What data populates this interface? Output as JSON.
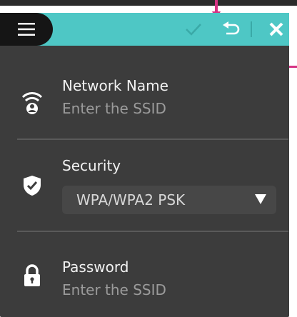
{
  "colors": {
    "header_accent": "#4ec7c5",
    "panel_bg": "#3c3c3c",
    "menu_bg": "#151515",
    "annotation": "#d63384"
  },
  "header": {
    "menu_icon": "hamburger-icon",
    "actions": [
      "check-icon",
      "undo-icon",
      "close-icon"
    ]
  },
  "network": {
    "icon": "wifi-person-icon",
    "label": "Network Name",
    "placeholder": "Enter the SSID"
  },
  "security": {
    "icon": "shield-check-icon",
    "label": "Security",
    "selected": "WPA/WPA2  PSK",
    "dropdown_icon": "triangle-down-icon"
  },
  "password": {
    "icon": "lock-icon",
    "label": "Password",
    "placeholder": "Enter the SSID"
  }
}
